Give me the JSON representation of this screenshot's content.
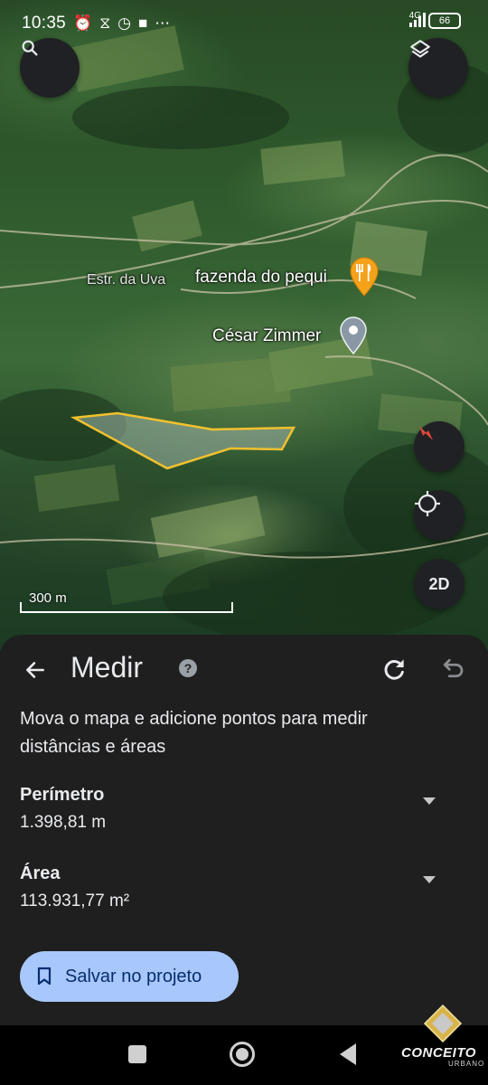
{
  "status_bar": {
    "time": "10:35",
    "network": "4G",
    "battery": "66"
  },
  "map": {
    "labels": {
      "road": "Estr. da Uva",
      "restaurant": "fazenda do pequi",
      "place": "César Zimmer"
    },
    "scale": "300 m",
    "view_mode": "2D",
    "polygon_color": "#f2c12e",
    "pin_restaurant_color": "#f4a21a",
    "pin_place_color": "#8a98a6"
  },
  "measure": {
    "title": "Medir",
    "help": "?",
    "instructions": "Mova o mapa e adicione pontos para medir distâncias e áreas",
    "perimeter": {
      "label": "Perímetro",
      "value": "1.398,81 m"
    },
    "area": {
      "label": "Área",
      "value": "113.931,77 m²"
    },
    "save_label": "Salvar no projeto",
    "accent": "#a8c7fa"
  },
  "watermark": {
    "name": "CONCEITO",
    "sub": "URBANO"
  }
}
